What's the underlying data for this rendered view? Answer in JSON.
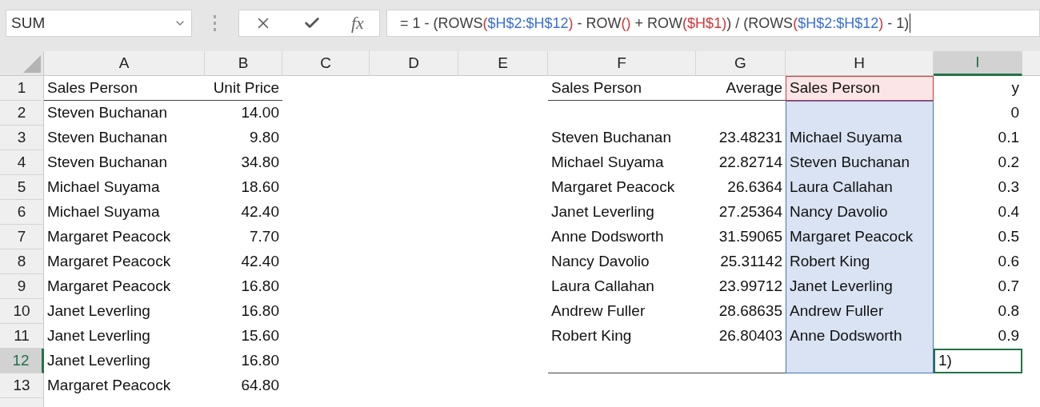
{
  "formula_bar": {
    "name_box": "SUM",
    "function_button": "fx",
    "formula": [
      {
        "text": "= 1 - (ROWS",
        "color": "#404040"
      },
      {
        "text": "(",
        "color": "#d13438"
      },
      {
        "text": "$H$2:$H$12",
        "color": "#3a6fd8"
      },
      {
        "text": ")",
        "color": "#d13438"
      },
      {
        "text": " - ROW",
        "color": "#404040"
      },
      {
        "text": "()",
        "color": "#d13438"
      },
      {
        "text": " + ROW",
        "color": "#404040"
      },
      {
        "text": "(",
        "color": "#d13438"
      },
      {
        "text": "$H$1",
        "color": "#d13438"
      },
      {
        "text": ")",
        "color": "#d13438"
      },
      {
        "text": ") / (ROWS",
        "color": "#404040"
      },
      {
        "text": "(",
        "color": "#d13438"
      },
      {
        "text": "$H$2:$H$12",
        "color": "#3a6fd8"
      },
      {
        "text": ")",
        "color": "#d13438"
      },
      {
        "text": " - 1)",
        "color": "#404040"
      }
    ]
  },
  "columns": [
    {
      "label": "A",
      "selected": false
    },
    {
      "label": "B",
      "selected": false
    },
    {
      "label": "C",
      "selected": false
    },
    {
      "label": "D",
      "selected": false
    },
    {
      "label": "E",
      "selected": false
    },
    {
      "label": "F",
      "selected": false
    },
    {
      "label": "G",
      "selected": false
    },
    {
      "label": "H",
      "selected": false
    },
    {
      "label": "I",
      "selected": true
    }
  ],
  "rows": [
    {
      "number": "1",
      "selected": false,
      "cells": [
        {
          "text": "Sales Person",
          "right_aligned": false,
          "underlined": true
        },
        {
          "text": "Unit Price",
          "right_aligned": true,
          "underlined": true
        },
        null,
        null,
        null,
        {
          "text": "Sales Person",
          "right_aligned": false,
          "underlined": true
        },
        {
          "text": "Average",
          "right_aligned": true,
          "underlined": true
        },
        {
          "text": "Sales Person",
          "right_aligned": false,
          "underlined": false,
          "ref": {
            "kind": "second",
            "color": "#fbe5e6"
          }
        },
        {
          "text": "y",
          "right_aligned": true,
          "underlined": false
        }
      ]
    },
    {
      "number": "2",
      "selected": false,
      "cells": [
        {
          "text": "Steven Buchanan",
          "right_aligned": false,
          "underlined": false
        },
        {
          "text": "14.00",
          "right_aligned": true,
          "underlined": false
        },
        null,
        null,
        null,
        null,
        null,
        {
          "underlined": false,
          "ref": {
            "kind": "first",
            "color": "#dae3f3"
          }
        },
        {
          "text": "0",
          "right_aligned": true,
          "underlined": false
        }
      ]
    },
    {
      "number": "3",
      "selected": false,
      "cells": [
        {
          "text": "Steven Buchanan",
          "right_aligned": false,
          "underlined": false
        },
        {
          "text": "9.80",
          "right_aligned": true,
          "underlined": false
        },
        null,
        null,
        null,
        {
          "text": "Steven Buchanan",
          "right_aligned": false,
          "underlined": false
        },
        {
          "text": "23.48231",
          "right_aligned": true,
          "underlined": false
        },
        {
          "text": "Michael Suyama",
          "right_aligned": false,
          "underlined": false,
          "ref": {
            "kind": "first",
            "color": "#dae3f3"
          }
        },
        {
          "text": "0.1",
          "right_aligned": true,
          "underlined": false
        }
      ]
    },
    {
      "number": "4",
      "selected": false,
      "cells": [
        {
          "text": "Steven Buchanan",
          "right_aligned": false,
          "underlined": false
        },
        {
          "text": "34.80",
          "right_aligned": true,
          "underlined": false
        },
        null,
        null,
        null,
        {
          "text": "Michael Suyama",
          "right_aligned": false,
          "underlined": false
        },
        {
          "text": "22.82714",
          "right_aligned": true,
          "underlined": false
        },
        {
          "text": "Steven Buchanan",
          "right_aligned": false,
          "underlined": false,
          "ref": {
            "kind": "first",
            "color": "#dae3f3"
          }
        },
        {
          "text": "0.2",
          "right_aligned": true,
          "underlined": false
        }
      ]
    },
    {
      "number": "5",
      "selected": false,
      "cells": [
        {
          "text": "Michael Suyama",
          "right_aligned": false,
          "underlined": false
        },
        {
          "text": "18.60",
          "right_aligned": true,
          "underlined": false
        },
        null,
        null,
        null,
        {
          "text": "Margaret Peacock",
          "right_aligned": false,
          "underlined": false
        },
        {
          "text": "26.6364",
          "right_aligned": true,
          "underlined": false
        },
        {
          "text": "Laura Callahan",
          "right_aligned": false,
          "underlined": false,
          "ref": {
            "kind": "first",
            "color": "#dae3f3"
          }
        },
        {
          "text": "0.3",
          "right_aligned": true,
          "underlined": false
        }
      ]
    },
    {
      "number": "6",
      "selected": false,
      "cells": [
        {
          "text": "Michael Suyama",
          "right_aligned": false,
          "underlined": false
        },
        {
          "text": "42.40",
          "right_aligned": true,
          "underlined": false
        },
        null,
        null,
        null,
        {
          "text": "Janet Leverling",
          "right_aligned": false,
          "underlined": false
        },
        {
          "text": "27.25364",
          "right_aligned": true,
          "underlined": false
        },
        {
          "text": "Nancy Davolio",
          "right_aligned": false,
          "underlined": false,
          "ref": {
            "kind": "first",
            "color": "#dae3f3"
          }
        },
        {
          "text": "0.4",
          "right_aligned": true,
          "underlined": false
        }
      ]
    },
    {
      "number": "7",
      "selected": false,
      "cells": [
        {
          "text": "Margaret Peacock",
          "right_aligned": false,
          "underlined": false
        },
        {
          "text": "7.70",
          "right_aligned": true,
          "underlined": false
        },
        null,
        null,
        null,
        {
          "text": "Anne Dodsworth",
          "right_aligned": false,
          "underlined": false
        },
        {
          "text": "31.59065",
          "right_aligned": true,
          "underlined": false
        },
        {
          "text": "Margaret Peacock",
          "right_aligned": false,
          "underlined": false,
          "ref": {
            "kind": "first",
            "color": "#dae3f3"
          }
        },
        {
          "text": "0.5",
          "right_aligned": true,
          "underlined": false
        }
      ]
    },
    {
      "number": "8",
      "selected": false,
      "cells": [
        {
          "text": "Margaret Peacock",
          "right_aligned": false,
          "underlined": false
        },
        {
          "text": "42.40",
          "right_aligned": true,
          "underlined": false
        },
        null,
        null,
        null,
        {
          "text": "Nancy Davolio",
          "right_aligned": false,
          "underlined": false
        },
        {
          "text": "25.31142",
          "right_aligned": true,
          "underlined": false
        },
        {
          "text": "Robert King",
          "right_aligned": false,
          "underlined": false,
          "ref": {
            "kind": "first",
            "color": "#dae3f3"
          }
        },
        {
          "text": "0.6",
          "right_aligned": true,
          "underlined": false
        }
      ]
    },
    {
      "number": "9",
      "selected": false,
      "cells": [
        {
          "text": "Margaret Peacock",
          "right_aligned": false,
          "underlined": false
        },
        {
          "text": "16.80",
          "right_aligned": true,
          "underlined": false
        },
        null,
        null,
        null,
        {
          "text": "Laura Callahan",
          "right_aligned": false,
          "underlined": false
        },
        {
          "text": "23.99712",
          "right_aligned": true,
          "underlined": false
        },
        {
          "text": "Janet Leverling",
          "right_aligned": false,
          "underlined": false,
          "ref": {
            "kind": "first",
            "color": "#dae3f3"
          }
        },
        {
          "text": "0.7",
          "right_aligned": true,
          "underlined": false
        }
      ]
    },
    {
      "number": "10",
      "selected": false,
      "cells": [
        {
          "text": "Janet Leverling",
          "right_aligned": false,
          "underlined": false
        },
        {
          "text": "16.80",
          "right_aligned": true,
          "underlined": false
        },
        null,
        null,
        null,
        {
          "text": "Andrew Fuller",
          "right_aligned": false,
          "underlined": false
        },
        {
          "text": "28.68635",
          "right_aligned": true,
          "underlined": false
        },
        {
          "text": "Andrew Fuller",
          "right_aligned": false,
          "underlined": false,
          "ref": {
            "kind": "first",
            "color": "#dae3f3"
          }
        },
        {
          "text": "0.8",
          "right_aligned": true,
          "underlined": false
        }
      ]
    },
    {
      "number": "11",
      "selected": false,
      "cells": [
        {
          "text": "Janet Leverling",
          "right_aligned": false,
          "underlined": false
        },
        {
          "text": "15.60",
          "right_aligned": true,
          "underlined": false
        },
        null,
        null,
        null,
        {
          "text": "Robert King",
          "right_aligned": false,
          "underlined": false
        },
        {
          "text": "26.80403",
          "right_aligned": true,
          "underlined": false
        },
        {
          "text": "Anne Dodsworth",
          "right_aligned": false,
          "underlined": false,
          "ref": {
            "kind": "first",
            "color": "#dae3f3"
          }
        },
        {
          "text": "0.9",
          "right_aligned": true,
          "underlined": false
        }
      ]
    },
    {
      "number": "12",
      "selected": true,
      "cells": [
        {
          "text": "Janet Leverling",
          "right_aligned": false,
          "underlined": false
        },
        {
          "text": "16.80",
          "right_aligned": true,
          "underlined": false
        },
        null,
        null,
        null,
        {
          "underlined": true
        },
        {
          "underlined": true
        },
        {
          "underlined": false,
          "ref": {
            "kind": "first",
            "color": "#dae3f3"
          }
        },
        {
          "text": "1)",
          "right_aligned": false
        }
      ]
    },
    {
      "number": "13",
      "selected": false,
      "cells": [
        {
          "text": "Margaret Peacock",
          "right_aligned": false,
          "underlined": false
        },
        {
          "text": "64.80",
          "right_aligned": true,
          "underlined": false
        },
        null,
        null,
        null,
        null,
        null,
        null,
        null
      ]
    }
  ]
}
